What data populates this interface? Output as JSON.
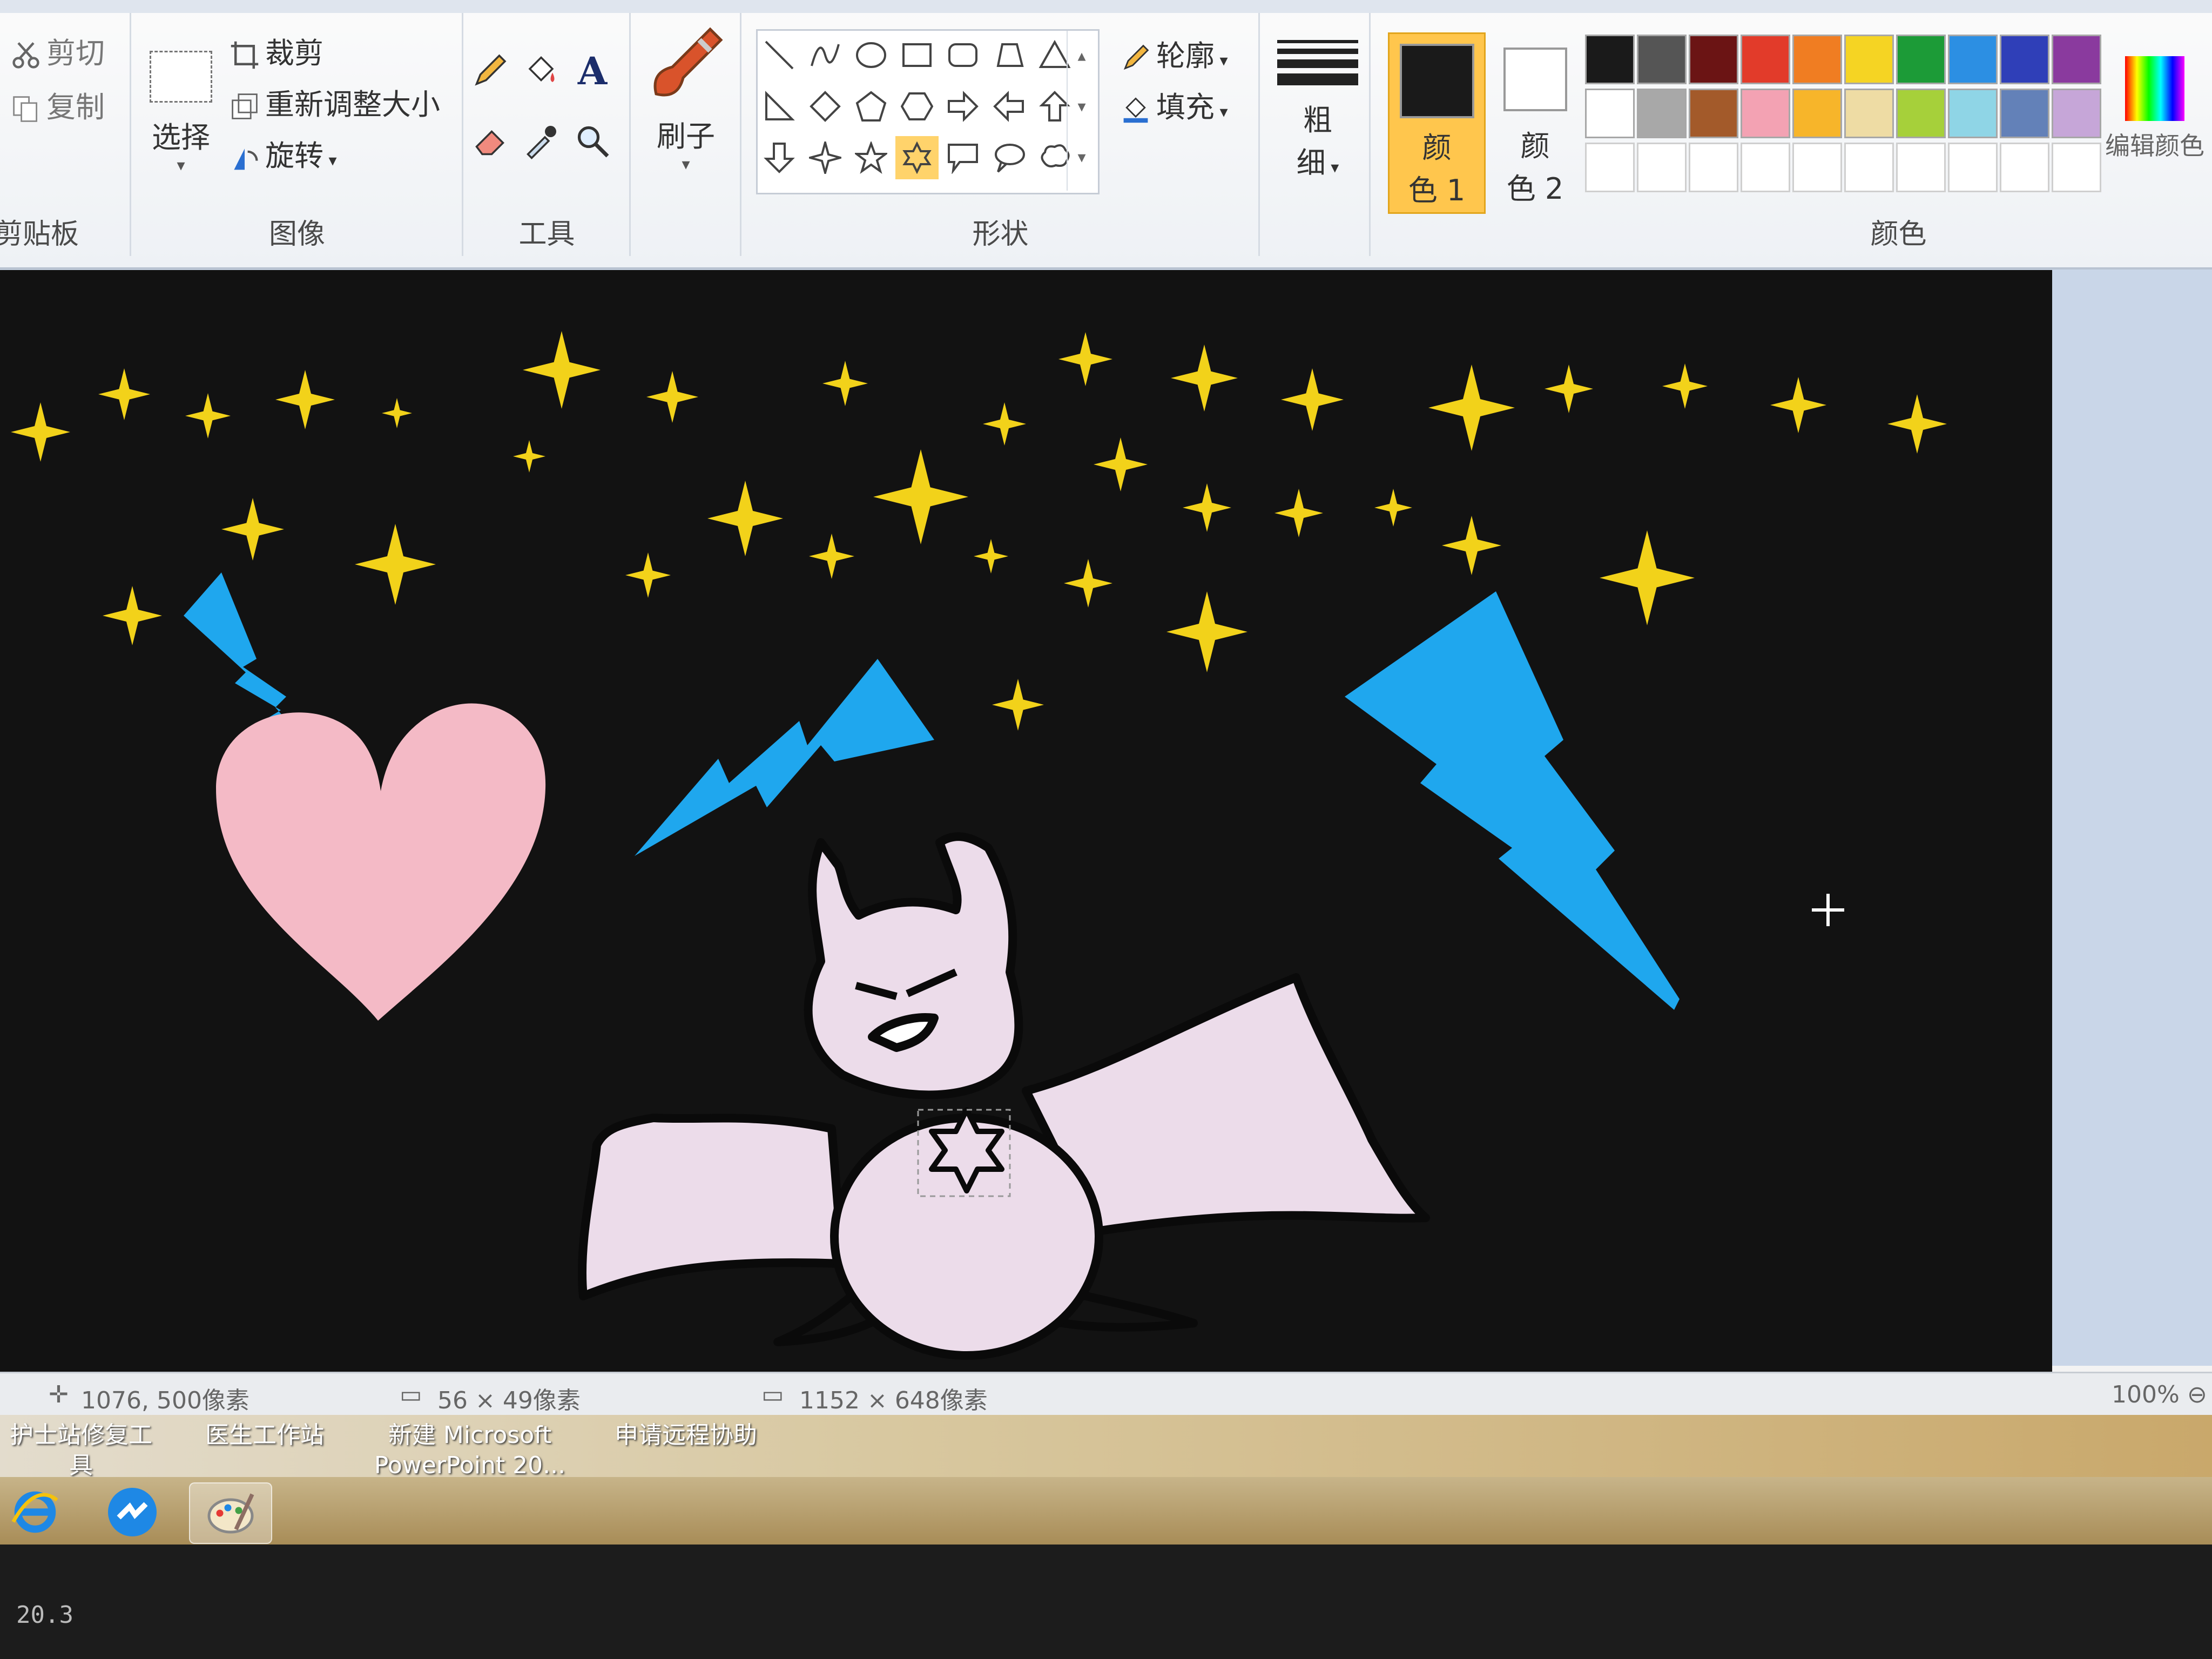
{
  "ribbon": {
    "clipboard": {
      "cut": "剪切",
      "copy": "复制",
      "label": "剪贴板"
    },
    "image": {
      "select": "选择",
      "crop": "裁剪",
      "resize": "重新调整大小",
      "rotate": "旋转",
      "label": "图像"
    },
    "tools": {
      "label": "工具"
    },
    "brush": {
      "label": "刷子"
    },
    "shapes": {
      "outline": "轮廓",
      "fill": "填充",
      "label": "形状"
    },
    "size": {
      "label_line1": "粗",
      "label_line2": "细"
    },
    "color1": {
      "line1": "颜",
      "line2": "色 1"
    },
    "color2": {
      "line1": "颜",
      "line2": "色 2"
    },
    "colors": {
      "label": "颜色",
      "edit": "编辑颜色"
    },
    "palette_row1": [
      "#1a1a1a",
      "#555555",
      "#6b1414",
      "#e23b2a",
      "#f07d22",
      "#f5d423",
      "#1c9b37",
      "#2c8fe3",
      "#2f3fb8",
      "#8a3a9e"
    ],
    "palette_row2": [
      "#ffffff",
      "#a8a8a8",
      "#a35a2a",
      "#f3a2b3",
      "#f7b52a",
      "#eedca4",
      "#a6d03a",
      "#8fd5e6",
      "#6381b8",
      "#c6a6d8"
    ]
  },
  "status": {
    "cursor_pos": "1076, 500像素",
    "selection_size": "56 × 49像素",
    "canvas_size": "1152 × 648像素",
    "zoom": "100%"
  },
  "desktop": {
    "icon1": "护士站修复工\n具",
    "icon2": "医生工作站",
    "icon3_line1": "新建 Microsoft",
    "icon3_line2": "PowerPoint 20...",
    "icon4": "申请远程协助"
  },
  "bezel_text": "20.3"
}
